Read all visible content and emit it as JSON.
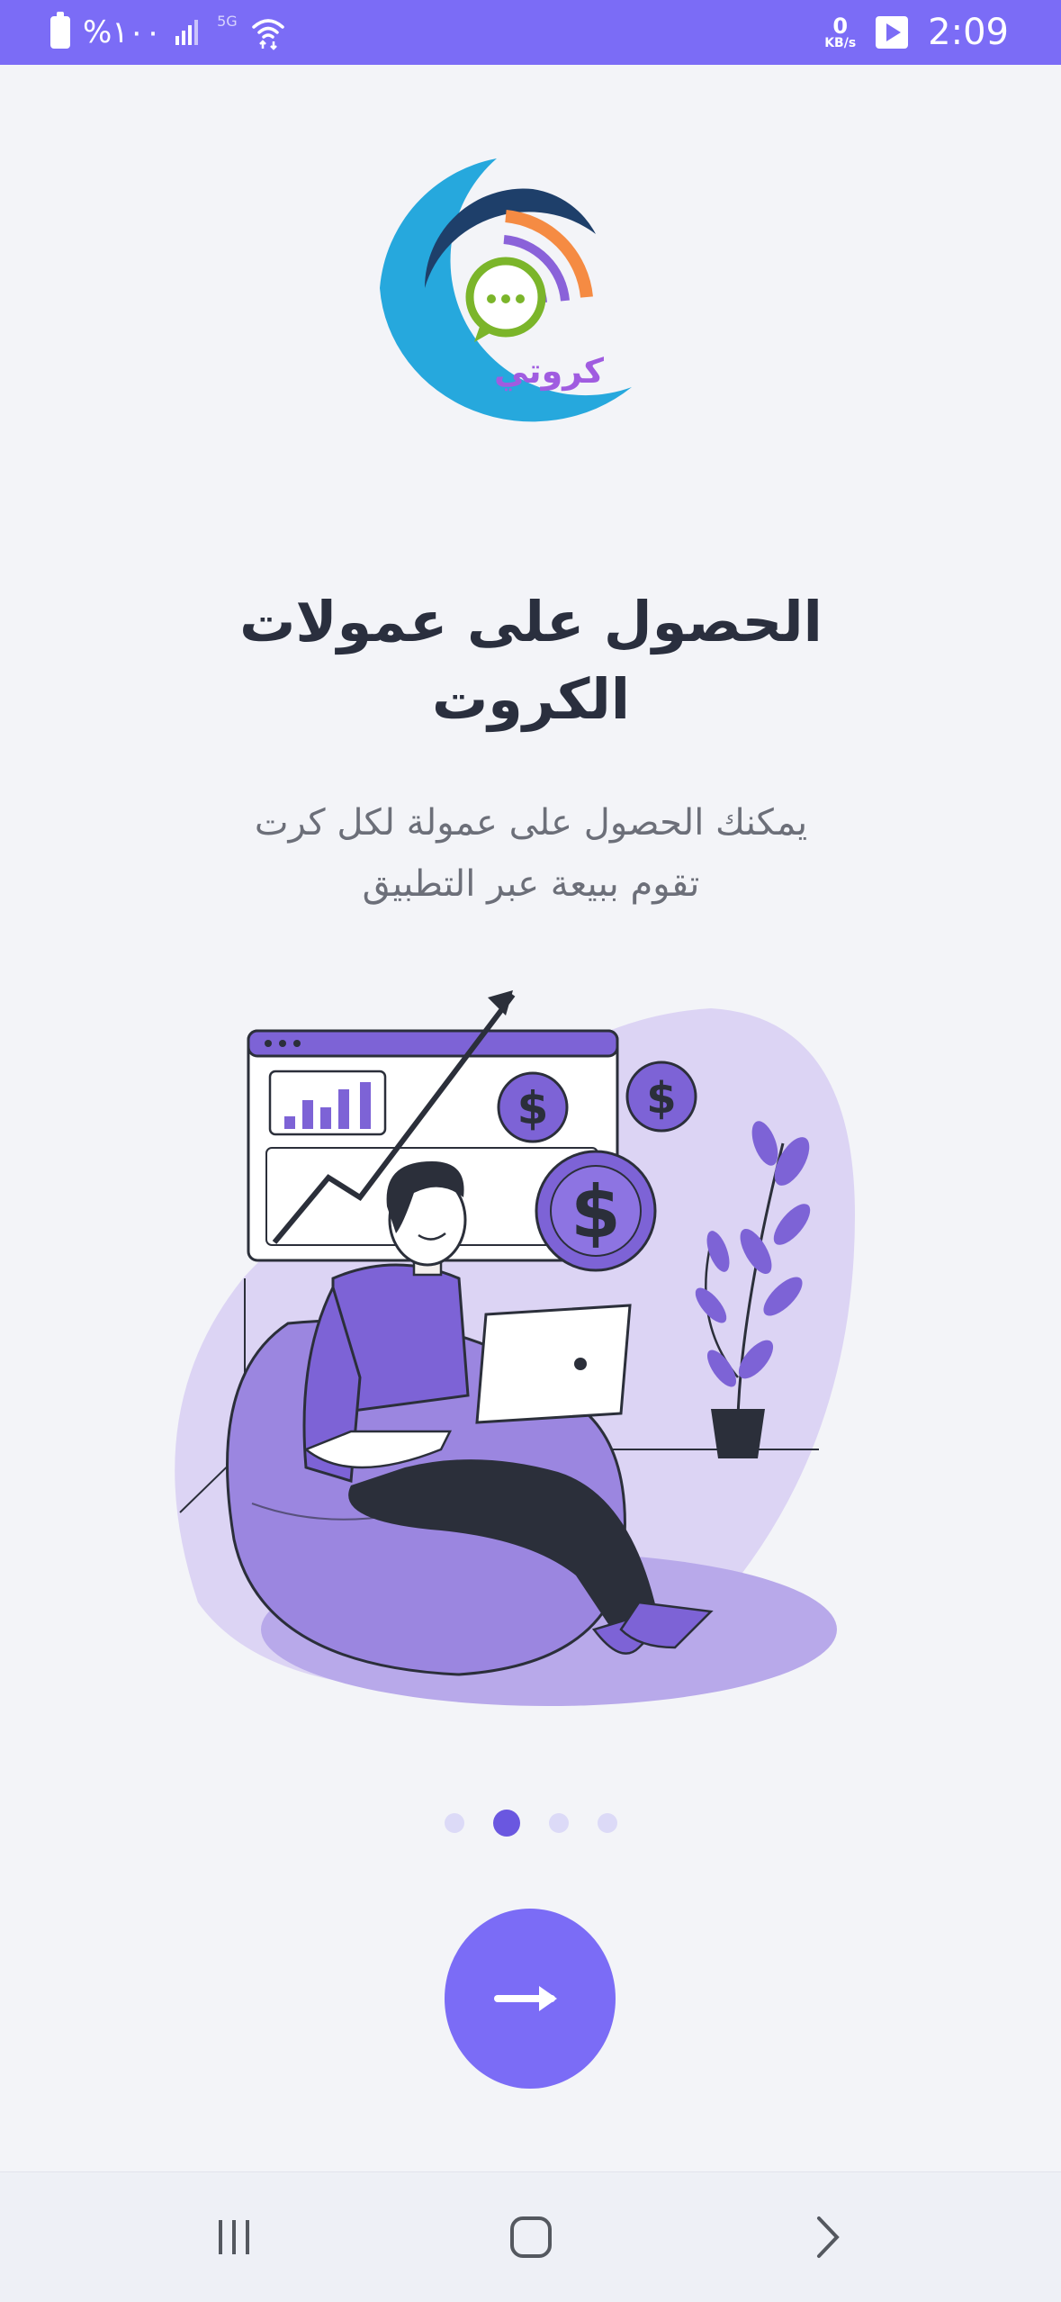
{
  "status_bar": {
    "battery_text": "%١٠٠",
    "network_text": "5G",
    "kbs_value": "0",
    "kbs_unit": "KB/s",
    "time": "2:09"
  },
  "logo": {
    "text": "كروتي",
    "icon": "chat-bubble-wifi-logo"
  },
  "onboarding": {
    "title_line1": "الحصول على عمولات",
    "title_line2": "الكروت",
    "subtitle_line1": "يمكنك الحصول على عمولة لكل كرت",
    "subtitle_line2": "تقوم ببيعة عبر التطبيق",
    "illustration": "man-on-beanbag-with-laptop-earnings-chart",
    "current_page": 2,
    "total_pages": 4
  },
  "next_button": {
    "icon": "arrow-right-icon"
  },
  "nav_bar": {
    "recents_icon": "recents-icon",
    "home_icon": "home-icon",
    "back_icon": "back-icon"
  },
  "colors": {
    "accent": "#7b6cf6",
    "dot_active": "#6a57e0",
    "dot_inactive": "#dcdaf7",
    "background": "#f3f4f8",
    "title": "#2a2f3e",
    "subtitle": "#6c6f79"
  }
}
